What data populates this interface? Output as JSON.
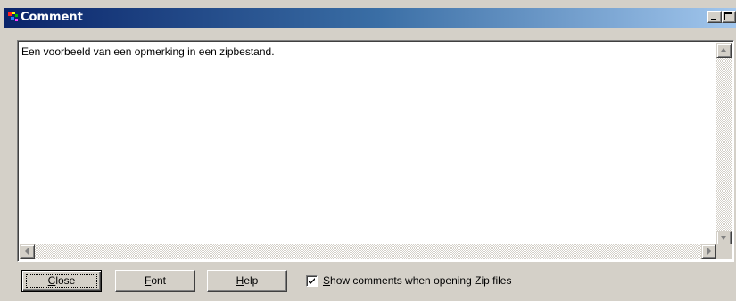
{
  "window": {
    "title": "Comment",
    "colors": {
      "titlebar_start": "#0a246a",
      "titlebar_end": "#a6caf0",
      "face": "#d4d0c8"
    }
  },
  "titlebar": {
    "buttons": [
      {
        "name": "minimize",
        "icon": "minimize-icon"
      },
      {
        "name": "maximize",
        "icon": "maximize-icon"
      },
      {
        "name": "close",
        "icon": "close-icon"
      }
    ]
  },
  "comment": {
    "text": "Een voorbeeld van een opmerking in een zipbestand."
  },
  "buttons": {
    "close": {
      "pre": "",
      "accel": "C",
      "post": "lose"
    },
    "font": {
      "pre": "",
      "accel": "F",
      "post": "ont"
    },
    "help": {
      "pre": "",
      "accel": "H",
      "post": "elp"
    }
  },
  "show_comments": {
    "checked": true,
    "pre": "",
    "accel": "S",
    "post": "how comments when opening Zip files"
  }
}
